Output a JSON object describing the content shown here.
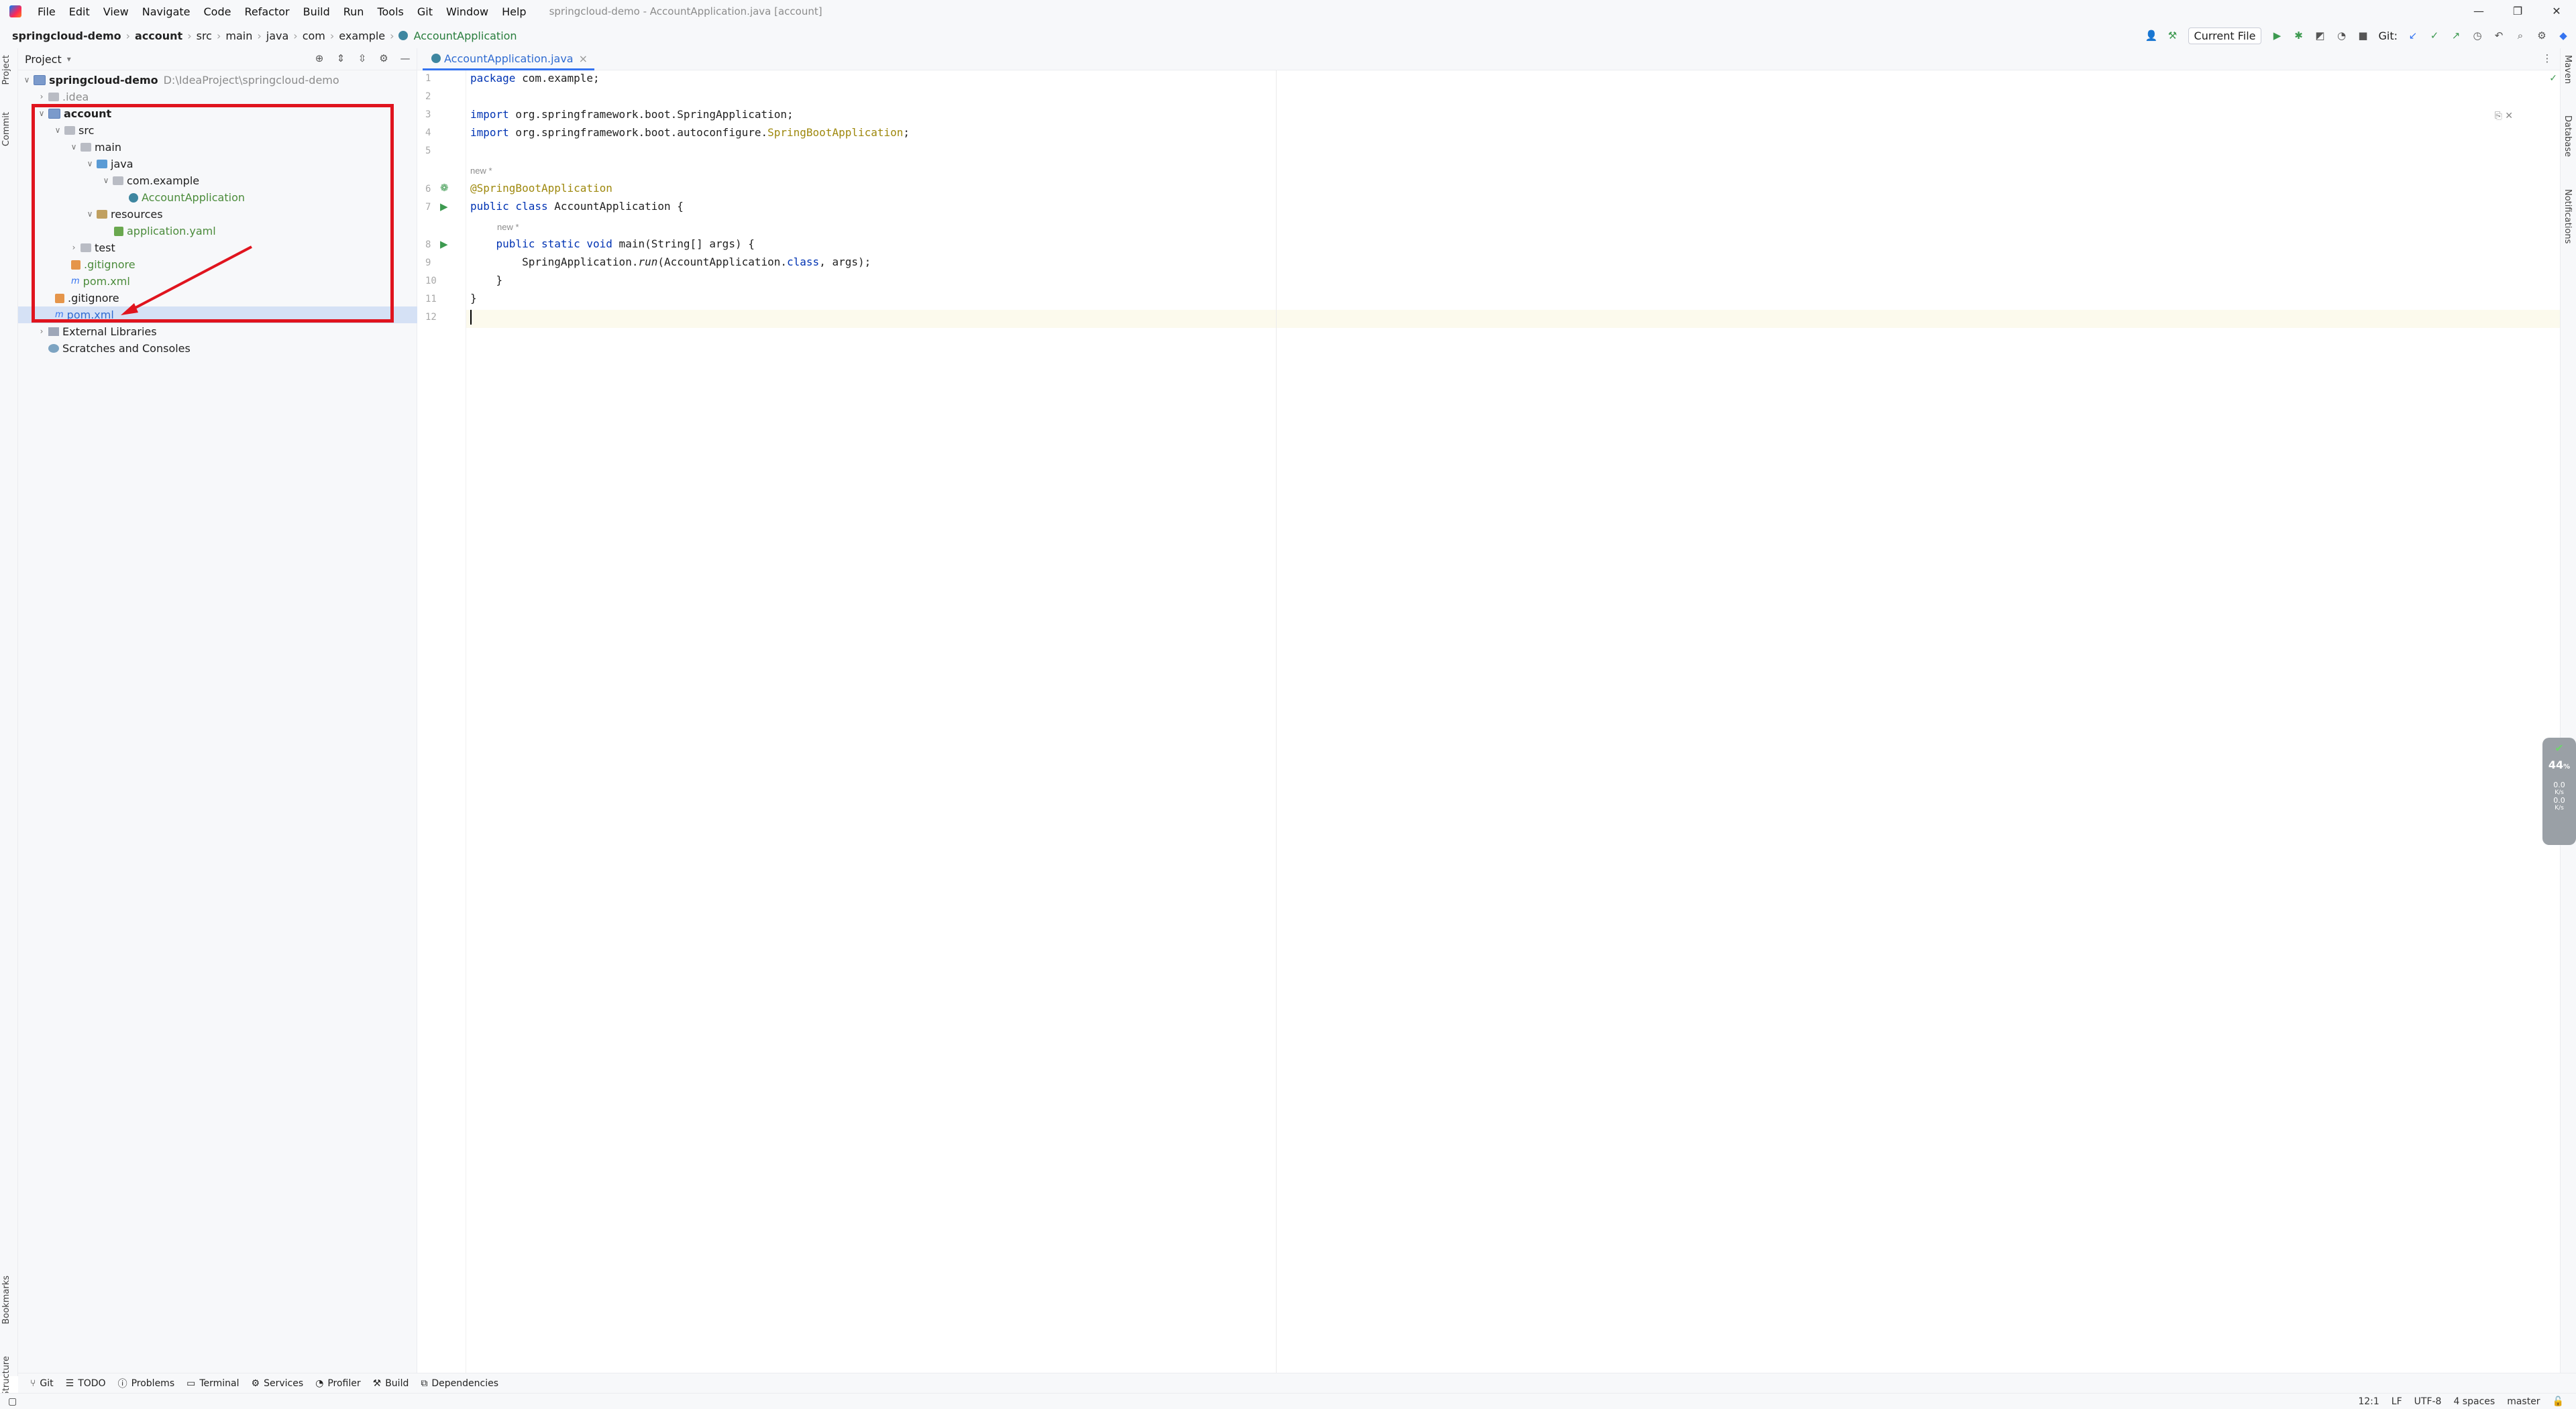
{
  "menubar": {
    "items": [
      "File",
      "Edit",
      "View",
      "Navigate",
      "Code",
      "Refactor",
      "Build",
      "Run",
      "Tools",
      "Git",
      "Window",
      "Help"
    ],
    "window_title": "springcloud-demo - AccountApplication.java [account]"
  },
  "window_controls": {
    "minimize": "—",
    "restore": "❐",
    "close": "✕"
  },
  "breadcrumb": [
    "springcloud-demo",
    "account",
    "src",
    "main",
    "java",
    "com",
    "example",
    "AccountApplication"
  ],
  "toolbar": {
    "run_config": "Current File",
    "git_label": "Git:"
  },
  "project_panel": {
    "title": "Project",
    "tree": [
      {
        "label": "springcloud-demo",
        "path": "D:\\IdeaProject\\springcloud-demo"
      },
      {
        "label": ".idea"
      },
      {
        "label": "account"
      },
      {
        "label": "src"
      },
      {
        "label": "main"
      },
      {
        "label": "java"
      },
      {
        "label": "com.example"
      },
      {
        "label": "AccountApplication"
      },
      {
        "label": "resources"
      },
      {
        "label": "application.yaml"
      },
      {
        "label": "test"
      },
      {
        "label": ".gitignore"
      },
      {
        "label": "pom.xml"
      },
      {
        "label": ".gitignore"
      },
      {
        "label": "pom.xml"
      },
      {
        "label": "External Libraries"
      },
      {
        "label": "Scratches and Consoles"
      }
    ]
  },
  "editor": {
    "tab_label": "AccountApplication.java",
    "tab_close": "×",
    "line_numbers": [
      "1",
      "2",
      "3",
      "4",
      "5",
      "6",
      "7",
      "8",
      "9",
      "10",
      "11",
      "12"
    ],
    "hints": {
      "new": "new *"
    },
    "lines": {
      "l1_kw": "package",
      "l1_rest": " com.example;",
      "l3_kw": "import",
      "l3_rest": " org.springframework.boot.SpringApplication;",
      "l4_kw": "import",
      "l4_rest": " org.springframework.boot.autoconfigure.",
      "l4_ann": "SpringBootApplication",
      "l4_end": ";",
      "l6_ann": "@SpringBootApplication",
      "l7_kw": "public class",
      "l7_rest": " AccountApplication {",
      "l8_kw": "    public static void",
      "l8_rest": " main(String[] args) {",
      "l9_a": "        SpringApplication.",
      "l9_run": "run",
      "l9_b": "(AccountApplication.",
      "l9_kw": "class",
      "l9_c": ", args);",
      "l10": "    }",
      "l11": "}"
    }
  },
  "right_stripe": [
    "Maven",
    "Database",
    "Notifications"
  ],
  "left_stripe": [
    "Project",
    "Commit",
    "Bookmarks",
    "Structure"
  ],
  "perf_widget": {
    "value": "44",
    "unit": "%",
    "up": "0.0",
    "up_unit": "K/s",
    "down": "0.0",
    "down_unit": "K/s"
  },
  "bottom_tools": [
    "Git",
    "TODO",
    "Problems",
    "Terminal",
    "Services",
    "Profiler",
    "Build",
    "Dependencies"
  ],
  "statusbar": {
    "position": "12:1",
    "line_sep": "LF",
    "encoding": "UTF-8",
    "indent": "4 spaces",
    "branch": "master"
  },
  "colors": {
    "annotation_red": "#e0141e",
    "accent": "#3574f0"
  }
}
